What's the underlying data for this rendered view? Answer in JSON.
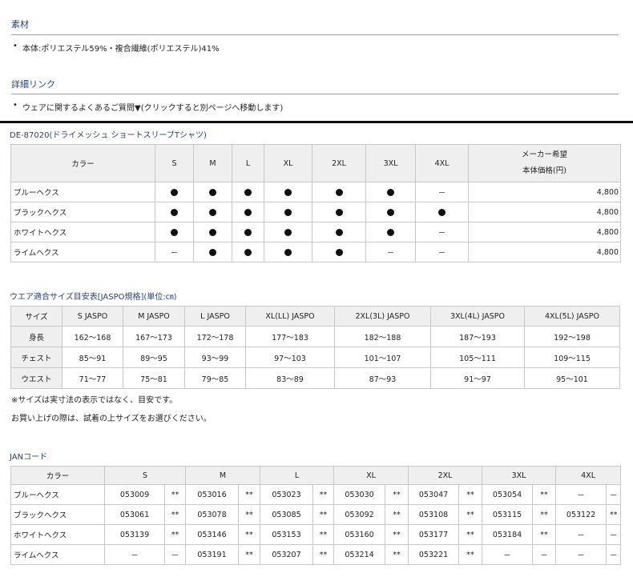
{
  "material": {
    "title": "素材",
    "items": [
      "本体:ポリエステル59%・複合繊維(ポリエステル)41%"
    ]
  },
  "links": {
    "title": "詳細リンク",
    "items": [
      "ウェアに関するよくあるご質問▼(クリックすると別ページへ移動します)"
    ]
  },
  "product_table": {
    "title": "DE-87020(ドライメッシュ ショートスリーブTシャツ)",
    "headers": [
      "カラー",
      "S",
      "M",
      "L",
      "XL",
      "2XL",
      "3XL",
      "4XL"
    ],
    "price_header": [
      "メーカー希望",
      "本体価格(円)"
    ],
    "rows": [
      {
        "color": "ブルーヘクス",
        "cells": [
          "●",
          "●",
          "●",
          "●",
          "●",
          "●",
          "－"
        ],
        "price": "4,800"
      },
      {
        "color": "ブラックヘクス",
        "cells": [
          "●",
          "●",
          "●",
          "●",
          "●",
          "●",
          "●"
        ],
        "price": "4,800"
      },
      {
        "color": "ホワイトヘクス",
        "cells": [
          "●",
          "●",
          "●",
          "●",
          "●",
          "●",
          "－"
        ],
        "price": "4,800"
      },
      {
        "color": "ライムヘクス",
        "cells": [
          "－",
          "●",
          "●",
          "●",
          "●",
          "－",
          "－"
        ],
        "price": "4,800"
      }
    ]
  },
  "size_table": {
    "title": "ウエア適合サイズ目安表[JASPO規格](単位:㎝)",
    "headers": [
      "サイズ",
      "S JASPO",
      "M JASPO",
      "L JASPO",
      "XL(LL) JASPO",
      "2XL(3L) JASPO",
      "3XL(4L) JASPO",
      "4XL(5L) JASPO"
    ],
    "rows": [
      {
        "label": "身長",
        "cells": [
          "162～168",
          "167～173",
          "172～178",
          "177～183",
          "182～188",
          "187～193",
          "192～198"
        ]
      },
      {
        "label": "チェスト",
        "cells": [
          "85～91",
          "89～95",
          "93～99",
          "97～103",
          "101～107",
          "105～111",
          "109～115"
        ]
      },
      {
        "label": "ウエスト",
        "cells": [
          "71～77",
          "75～81",
          "79～85",
          "83～89",
          "87～93",
          "91～97",
          "95～101"
        ]
      }
    ],
    "notes": [
      "※サイズは実寸法の表示ではなく、目安です。",
      "お買い上げの際は、試着の上サイズをお選びください。"
    ]
  },
  "jan_table": {
    "title": "JANコード",
    "headers": [
      "カラー",
      "S",
      "M",
      "L",
      "XL",
      "2XL",
      "3XL",
      "4XL"
    ],
    "rows": [
      {
        "color": "ブルーヘクス",
        "cells": [
          "053009",
          "**",
          "053016",
          "**",
          "053023",
          "**",
          "053030",
          "**",
          "053047",
          "**",
          "053054",
          "**",
          "－",
          "－"
        ]
      },
      {
        "color": "ブラックヘクス",
        "cells": [
          "053061",
          "**",
          "053078",
          "**",
          "053085",
          "**",
          "053092",
          "**",
          "053108",
          "**",
          "053115",
          "**",
          "053122",
          "**"
        ]
      },
      {
        "color": "ホワイトヘクス",
        "cells": [
          "053139",
          "**",
          "053146",
          "**",
          "053153",
          "**",
          "053160",
          "**",
          "053177",
          "**",
          "053184",
          "**",
          "－",
          "－"
        ]
      },
      {
        "color": "ライムヘクス",
        "cells": [
          "－",
          "－",
          "053191",
          "**",
          "053207",
          "**",
          "053214",
          "**",
          "053221",
          "**",
          "－",
          "－",
          "－",
          "－"
        ]
      }
    ]
  }
}
